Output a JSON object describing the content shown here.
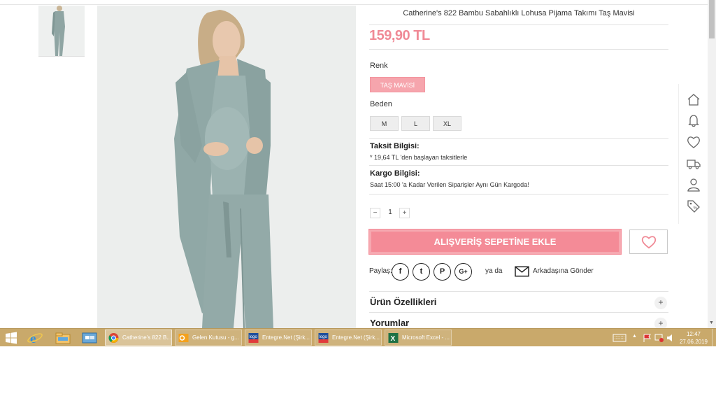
{
  "product": {
    "title": "Catherine's 822 Bambu Sabahlıklı Lohusa Pijama Takımı Taş Mavisi",
    "price": "159,90 TL",
    "color_label": "Renk",
    "color_option": "TAŞ MAVİSİ",
    "size_label": "Beden",
    "sizes": [
      "M",
      "L",
      "XL"
    ],
    "installment_title": "Taksit Bilgisi:",
    "installment_text": "* 19,64 TL 'den başlayan taksitlerle",
    "shipping_title": "Kargo Bilgisi:",
    "shipping_text": "Saat 15:00 'a Kadar Verilen Siparişler Aynı Gün Kargoda!",
    "quantity": "1",
    "qty_minus": "−",
    "qty_plus": "+",
    "add_to_cart": "ALIŞVERİŞ SEPETİNE EKLE",
    "share_label": "Paylaş:",
    "or_label": "ya da",
    "send_friend": "Arkadaşına Gönder",
    "accordion": [
      "Ürün Özellikleri",
      "Yorumlar"
    ],
    "accordion_plus": "+"
  },
  "social_icons": [
    "facebook-icon",
    "twitter-icon",
    "pinterest-icon",
    "google-plus-icon"
  ],
  "social_glyphs": [
    "f",
    "t",
    "P",
    "G+"
  ],
  "side_icons": [
    "home-icon",
    "bell-icon",
    "heart-icon",
    "truck-icon",
    "user-icon",
    "tag-icon"
  ],
  "taskbar": {
    "tasks": [
      {
        "label": "Catherine's 822 B...",
        "icon": "chrome-icon",
        "active": true
      },
      {
        "label": "Gelen Kutusu - g...",
        "icon": "outlook-icon",
        "active": false
      },
      {
        "label": "Entegre.Net (Şirk...",
        "icon": "logo-tiger-icon",
        "active": false
      },
      {
        "label": "Entegre.Net (Şirk...",
        "icon": "logo-tiger-icon",
        "active": false
      },
      {
        "label": "Microsoft Excel - ...",
        "icon": "excel-icon",
        "active": false
      }
    ],
    "clock_time": "12:47",
    "clock_date": "27.06.2019"
  },
  "colors": {
    "accent": "#f48b97",
    "price": "#f08a96",
    "taskbar": "#c9a96b"
  }
}
